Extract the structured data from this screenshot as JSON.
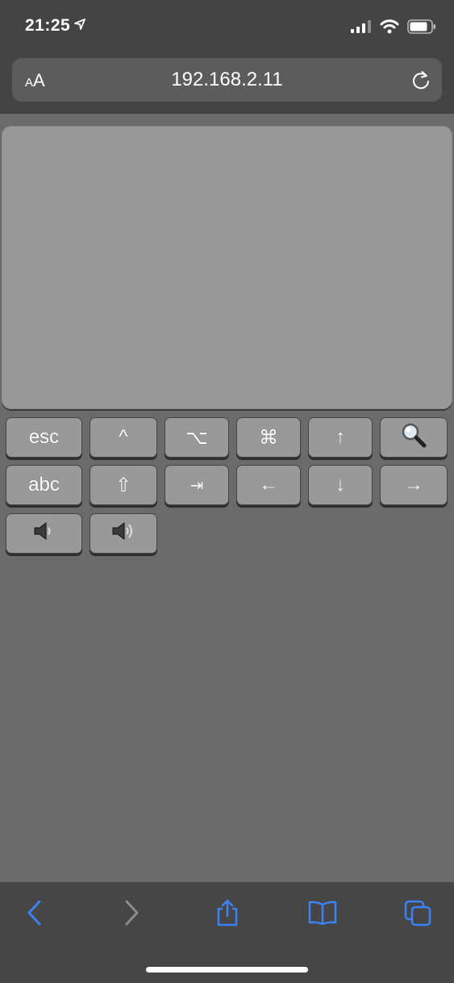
{
  "status_bar": {
    "time": "21:25",
    "icons": [
      "location-arrow-icon",
      "cellular-signal-icon",
      "wifi-icon",
      "battery-icon"
    ]
  },
  "url_bar": {
    "text_size_small": "A",
    "text_size_large": "A",
    "url": "192.168.2.11",
    "reload_icon": "reload-icon"
  },
  "keys": {
    "row1": [
      "esc",
      "^",
      "⌥",
      "⌘",
      "↑",
      "search-icon"
    ],
    "row2": [
      "abc",
      "⇧",
      "⇥",
      "←",
      "↓",
      "→"
    ],
    "row3": [
      "volume-down-icon",
      "volume-up-icon"
    ]
  },
  "toolbar": {
    "icons": [
      "back-icon",
      "forward-icon",
      "share-icon",
      "bookmarks-icon",
      "tabs-icon"
    ],
    "accent_color": "#3b82f6",
    "disabled_color": "#8c8c8c"
  },
  "colors": {
    "background": "#6b6b6b",
    "key": "#999999",
    "bars": "#444444"
  }
}
